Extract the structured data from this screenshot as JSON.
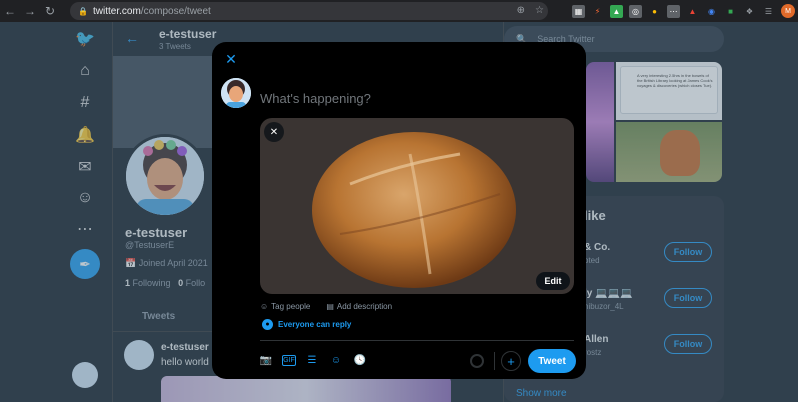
{
  "browser": {
    "url_host": "twitter.com",
    "url_path": "/compose/tweet",
    "profile_initials": "M"
  },
  "left_nav": {
    "icons": [
      "twitter-logo-icon",
      "home-icon",
      "explore-hash-icon",
      "notifications-bell-icon",
      "messages-envelope-icon",
      "profile-person-icon",
      "more-icon"
    ]
  },
  "profile": {
    "header_name": "e-testuser",
    "header_count": "3 Tweets",
    "name": "e-testuser",
    "handle": "@TestuserE",
    "joined": "Joined April 2021",
    "following_count": "1",
    "following_label": "Following",
    "followers_count": "0",
    "followers_label": "Follo",
    "tab_tweets": "Tweets",
    "tweet_name": "e-testuser",
    "tweet_handle": "@",
    "tweet_text": "hello world"
  },
  "sidebar": {
    "search_placeholder": "Search Twitter",
    "mini_tweet_text": "A very interesting 2.5hrs in the bowels of the British Library looking at James Cook's voyages & discoveries (which closes Tue).",
    "wtf_title": "like",
    "rows": [
      {
        "name": "& Co.",
        "handle": "",
        "extra": "oted",
        "follow": "Follow"
      },
      {
        "name": "ly",
        "handle": "hibuzor_4L",
        "extra": "",
        "follow": "Follow"
      },
      {
        "name": "Allen",
        "handle": "rostz",
        "extra": "",
        "follow": "Follow"
      }
    ],
    "show_more": "Show more"
  },
  "compose": {
    "placeholder": "What's happening?",
    "edit_label": "Edit",
    "tag_people": "Tag people",
    "add_description": "Add description",
    "reply_setting": "Everyone can reply",
    "tweet_button": "Tweet"
  },
  "colors": {
    "accent": "#1d9bf0",
    "background": "#15202b",
    "modal": "#000000"
  }
}
